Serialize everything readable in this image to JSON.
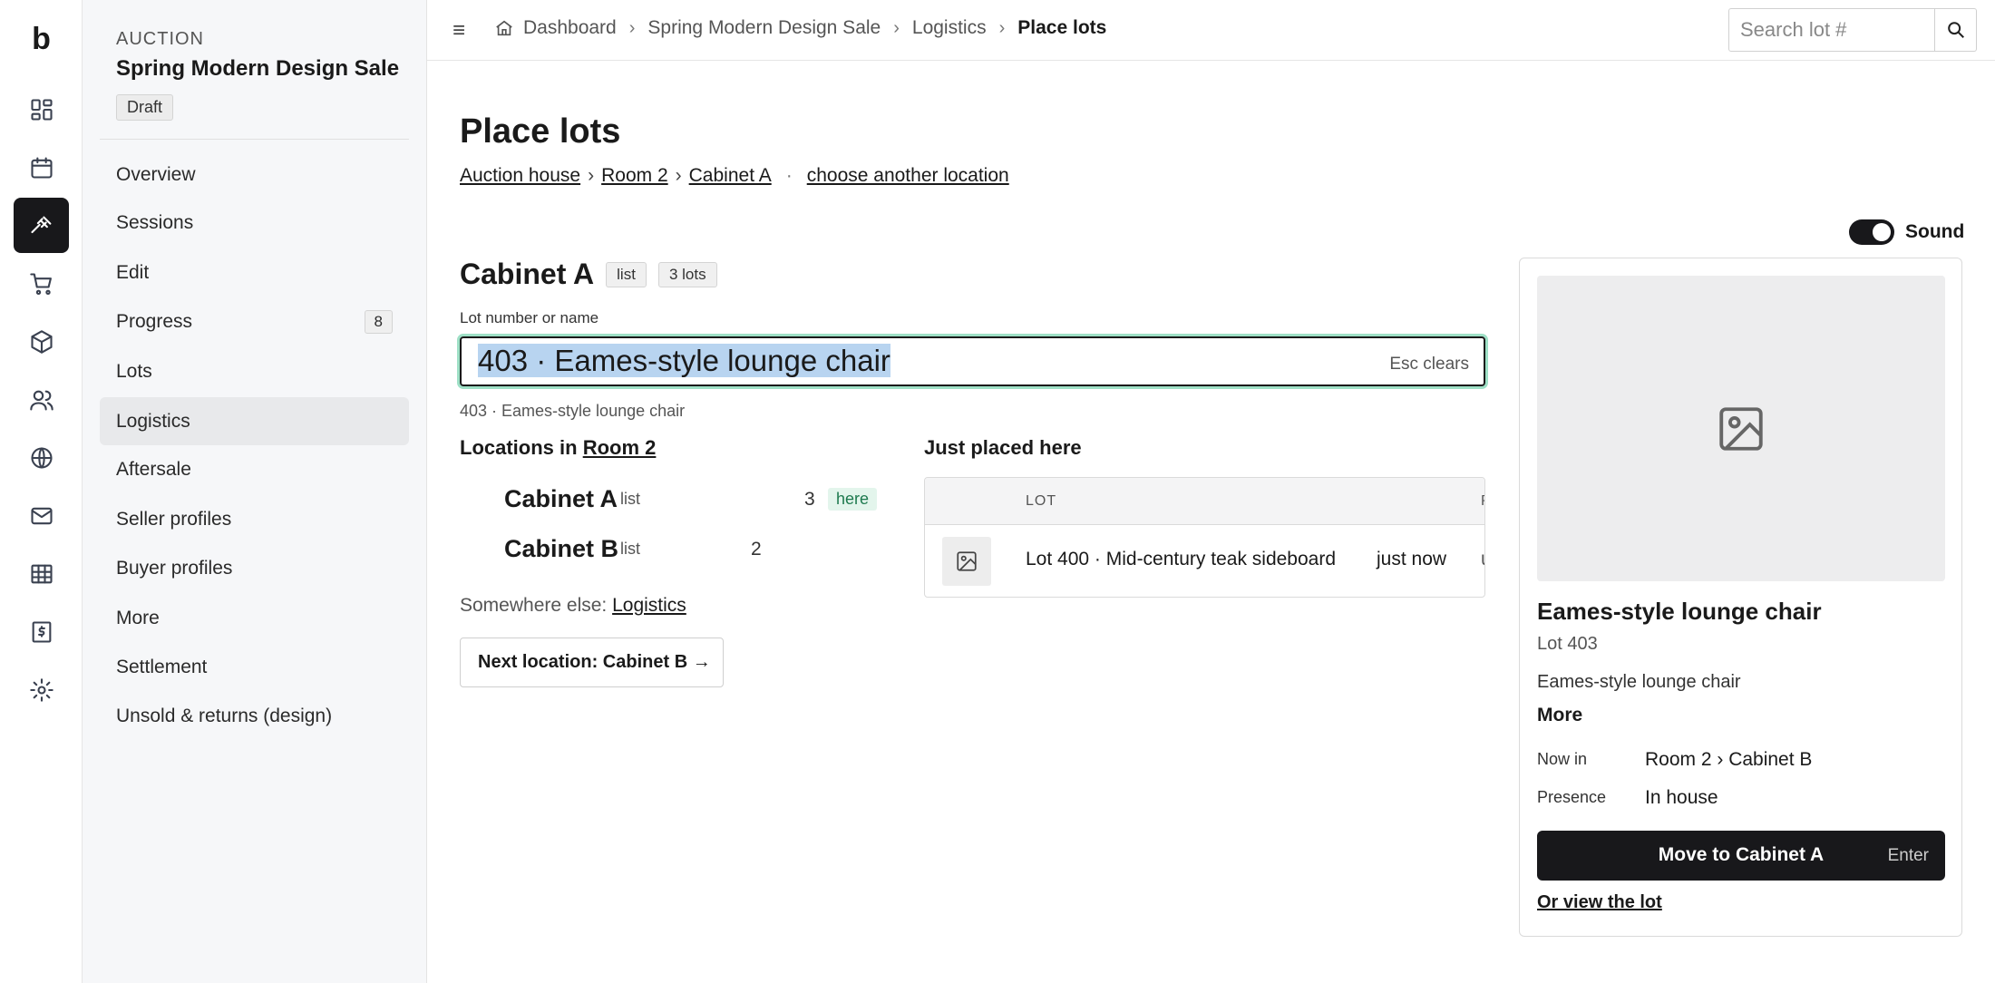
{
  "brand": {
    "logo": "b"
  },
  "rail": {
    "icons": [
      "dashboard-icon",
      "calendar-icon",
      "gavel-icon",
      "cart-icon",
      "box-icon",
      "users-icon",
      "globe-icon",
      "mail-icon",
      "table-icon",
      "receipt-icon",
      "gear-icon"
    ],
    "active": "gavel-icon"
  },
  "sidebar": {
    "kicker": "AUCTION",
    "sale_name": "Spring Modern Design Sale",
    "status": "Draft",
    "items": [
      {
        "label": "Overview"
      },
      {
        "label": "Sessions"
      },
      {
        "label": "Edit"
      },
      {
        "label": "Progress",
        "count": "8"
      },
      {
        "label": "Lots"
      },
      {
        "label": "Logistics",
        "active": true
      },
      {
        "label": "Aftersale"
      },
      {
        "label": "Seller profiles"
      },
      {
        "label": "Buyer profiles"
      },
      {
        "label": "More"
      },
      {
        "label": "Settlement"
      },
      {
        "label": "Unsold & returns (design)"
      }
    ]
  },
  "topbar": {
    "menu_icon": "≡",
    "breadcrumb": [
      "Dashboard",
      "Spring Modern Design Sale",
      "Logistics",
      "Place lots"
    ],
    "search_placeholder": "Search lot #"
  },
  "main": {
    "title": "Place lots",
    "location_path": [
      "Auction house",
      "Room 2",
      "Cabinet A"
    ],
    "path_sep": "›",
    "dot": "·",
    "choose_link": "choose another location",
    "sound_label": "Sound",
    "sound_on": true,
    "current_location": {
      "name": "Cabinet A",
      "kind": "list",
      "count": "3 lots"
    },
    "field_label": "Lot number or name",
    "field_value": "403 · Eames-style lounge chair",
    "esc_hint": "Esc clears",
    "match_hint": "403 · Eames-style lounge chair",
    "locations_heading": "Locations in",
    "locations_room": "Room 2",
    "locations": [
      {
        "name": "Cabinet A",
        "kind": "list",
        "count": "3",
        "badge": "here"
      },
      {
        "name": "Cabinet B",
        "kind": "list",
        "count": "2"
      }
    ],
    "elsewhere_label": "Somewhere else:",
    "elsewhere_link": "Logistics",
    "next_button": "Next location: Cabinet B →",
    "just_placed_heading": "Just placed here",
    "just_placed": {
      "columns": [
        "LOT",
        "P"
      ],
      "rows": [
        {
          "lot": "Lot 400 · Mid-century teak sideboard",
          "when": "just now",
          "extra": "u"
        }
      ]
    }
  },
  "card": {
    "title": "Eames-style lounge chair",
    "lot_no": "Lot 403",
    "desc": "Eames-style lounge chair",
    "more": "More",
    "now_in_label": "Now in",
    "now_in_value": "Room 2 › Cabinet B",
    "presence_label": "Presence",
    "presence_value": "In house",
    "move_button": "Move to Cabinet A",
    "move_key": "Enter",
    "view_link": "Or view the lot"
  },
  "colors": {
    "primary": "#18181b",
    "focus_ring": "#9ee0c6",
    "here_badge": "#1e7a4f",
    "selection": "#b8d4f0"
  }
}
